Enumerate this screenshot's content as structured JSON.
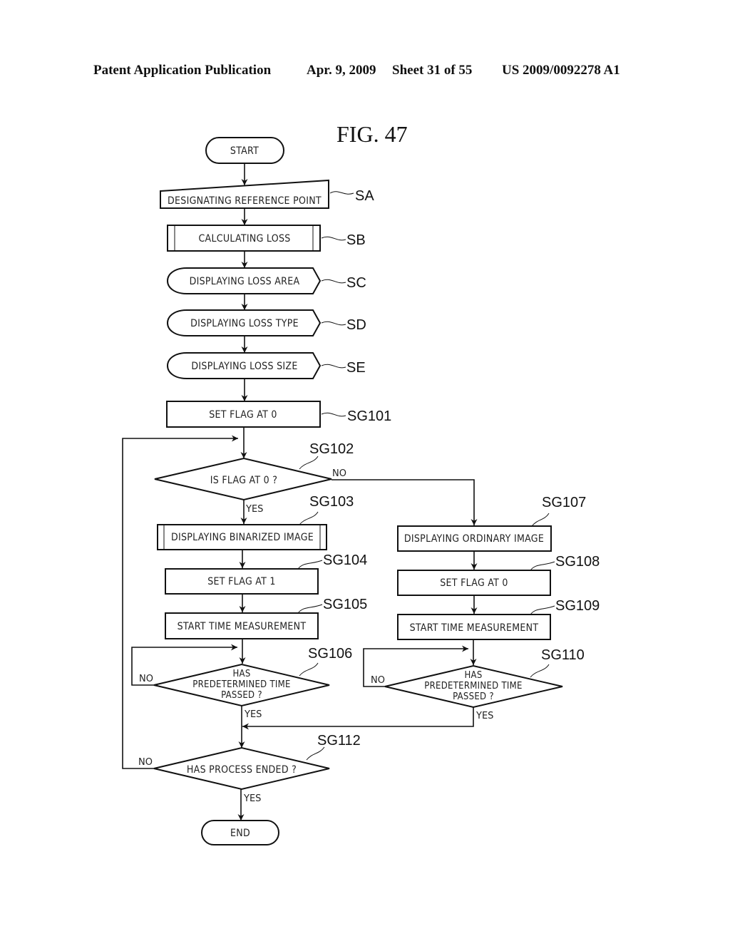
{
  "header": {
    "publication": "Patent Application Publication",
    "date": "Apr. 9, 2009",
    "sheet": "Sheet 31 of 55",
    "patent_number": "US 2009/0092278 A1"
  },
  "figure": {
    "title": "FIG. 47"
  },
  "steps": {
    "start": {
      "text": "START"
    },
    "sa": {
      "text": "DESIGNATING REFERENCE POINT",
      "ref": "SA"
    },
    "sb": {
      "text": "CALCULATING LOSS",
      "ref": "SB"
    },
    "sc": {
      "text": "DISPLAYING LOSS AREA",
      "ref": "SC"
    },
    "sd": {
      "text": "DISPLAYING LOSS TYPE",
      "ref": "SD"
    },
    "se": {
      "text": "DISPLAYING LOSS SIZE",
      "ref": "SE"
    },
    "sg101": {
      "text": "SET FLAG AT 0",
      "ref": "SG101"
    },
    "sg102": {
      "text": "IS FLAG AT 0 ?",
      "ref": "SG102"
    },
    "sg103": {
      "text": "DISPLAYING BINARIZED IMAGE",
      "ref": "SG103"
    },
    "sg104": {
      "text": "SET FLAG AT 1",
      "ref": "SG104"
    },
    "sg105": {
      "text": "START TIME MEASUREMENT",
      "ref": "SG105"
    },
    "sg106": {
      "line1": "HAS",
      "line2": "PREDETERMINED TIME",
      "line3": "PASSED ?",
      "ref": "SG106"
    },
    "sg107": {
      "text": "DISPLAYING ORDINARY IMAGE",
      "ref": "SG107"
    },
    "sg108": {
      "text": "SET FLAG AT 0",
      "ref": "SG108"
    },
    "sg109": {
      "text": "START TIME MEASUREMENT",
      "ref": "SG109"
    },
    "sg110": {
      "line1": "HAS",
      "line2": "PREDETERMINED TIME",
      "line3": "PASSED ?",
      "ref": "SG110"
    },
    "sg112": {
      "text": "HAS PROCESS ENDED ?",
      "ref": "SG112"
    },
    "end": {
      "text": "END"
    }
  },
  "branch_labels": {
    "yes": "YES",
    "no": "NO"
  }
}
